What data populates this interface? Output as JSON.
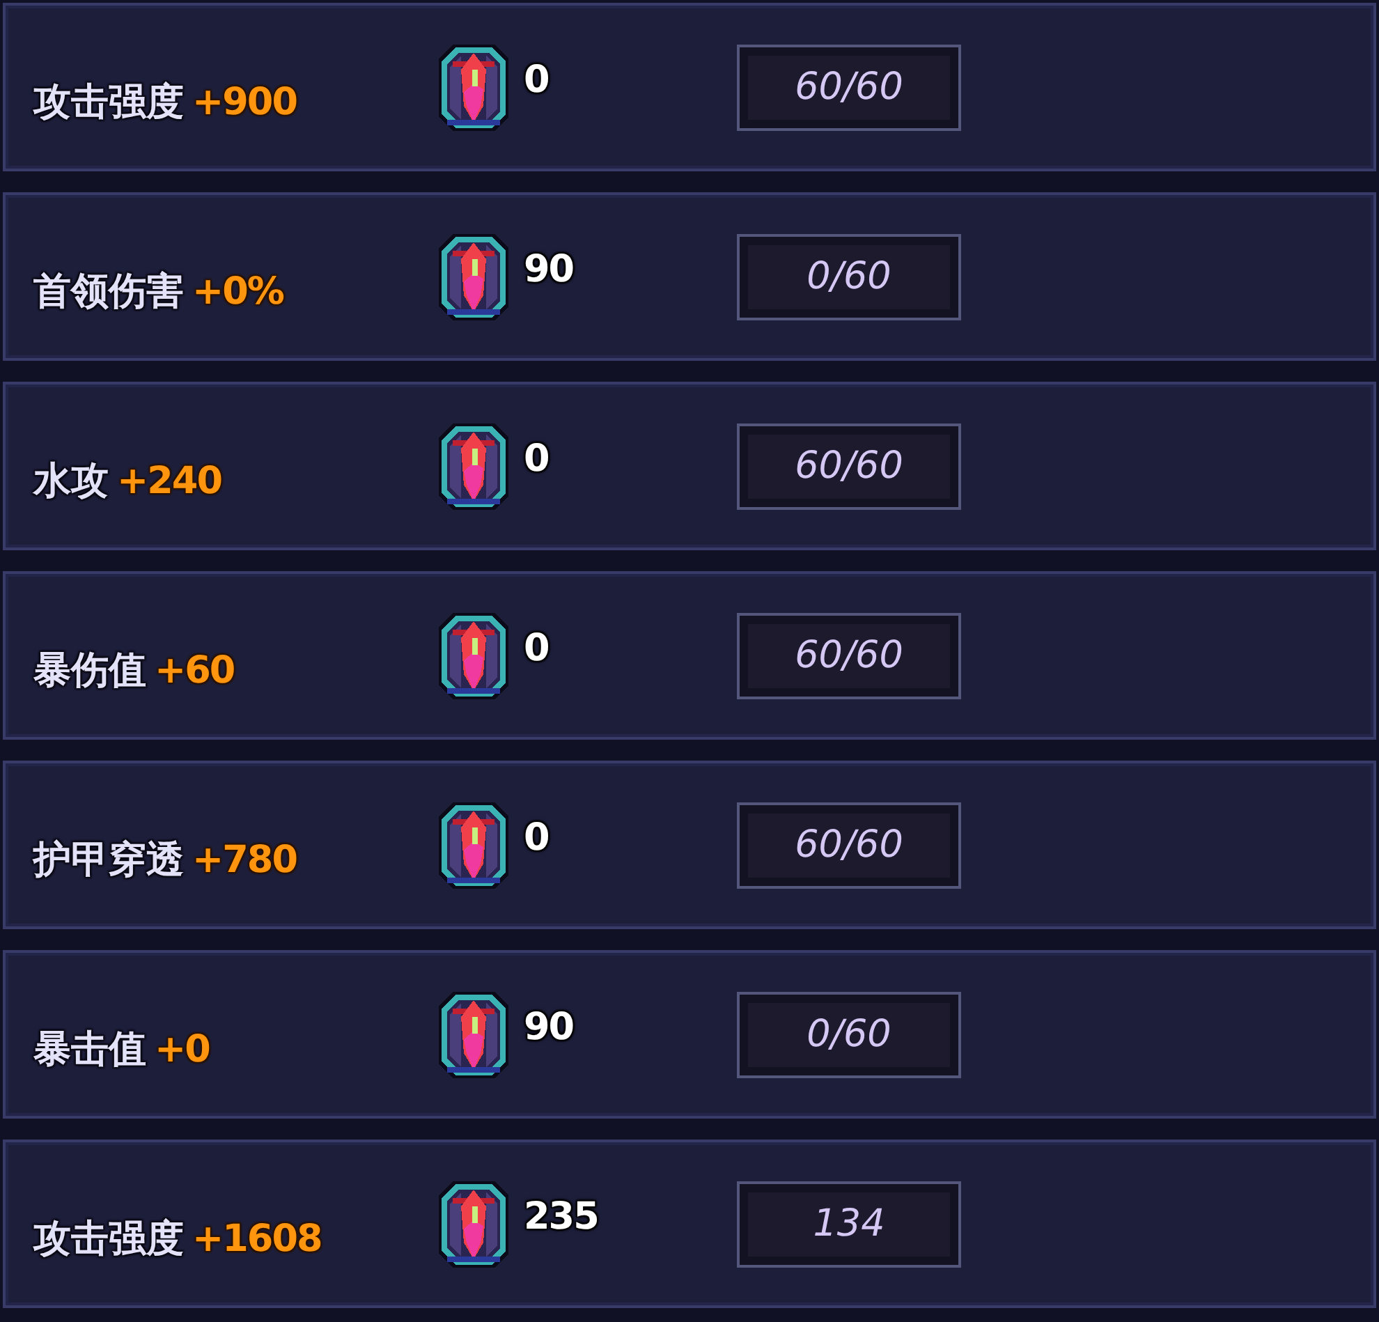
{
  "rows": [
    {
      "stat": "攻击强度",
      "bonus": "+900",
      "cost": "0",
      "count": "60/60"
    },
    {
      "stat": "首领伤害",
      "bonus": "+0%",
      "cost": "90",
      "count": "0/60"
    },
    {
      "stat": "水攻",
      "bonus": "+240",
      "cost": "0",
      "count": "60/60"
    },
    {
      "stat": "暴伤值",
      "bonus": "+60",
      "cost": "0",
      "count": "60/60"
    },
    {
      "stat": "护甲穿透",
      "bonus": "+780",
      "cost": "0",
      "count": "60/60"
    },
    {
      "stat": "暴击值",
      "bonus": "+0",
      "cost": "90",
      "count": "0/60"
    },
    {
      "stat": "攻击强度",
      "bonus": "+1608",
      "cost": "235",
      "count": "134"
    }
  ]
}
